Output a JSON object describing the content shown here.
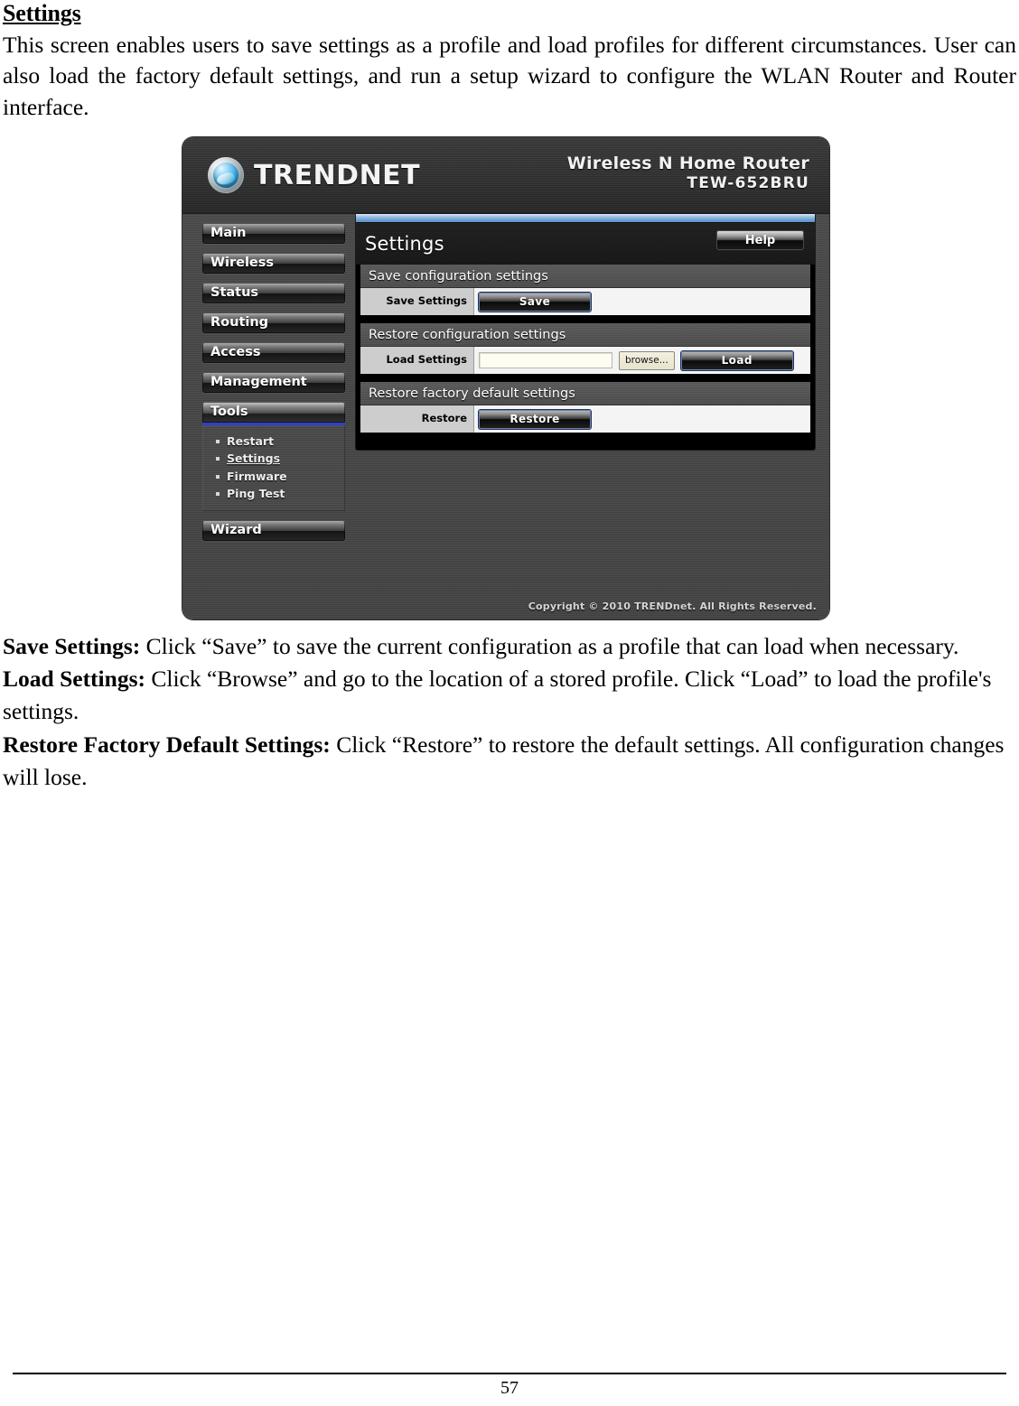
{
  "document": {
    "heading": "Settings",
    "intro": "This screen enables users to save settings as a profile and load profiles for different circumstances. User can also load the factory default settings, and run a setup wizard to configure the WLAN Router and Router interface.",
    "sections": [
      {
        "term": "Save Settings:",
        "text": " Click “Save” to save the current configuration as a profile that can load when necessary."
      },
      {
        "term": "Load Settings:",
        "text": " Click “Browse” and go to the location of a stored profile. Click “Load” to load the profile's settings."
      },
      {
        "term": "Restore Factory Default Settings:",
        "text": " Click “Restore” to restore the default settings. All configuration changes will lose."
      }
    ],
    "page_number": "57"
  },
  "router_ui": {
    "brand": {
      "logo_icon": "trendnet-globe-icon",
      "wordmark": "TRENDNET",
      "product_name": "Wireless N Home Router",
      "model": "TEW-652BRU"
    },
    "sidebar": {
      "items": [
        {
          "label": "Main",
          "active": false
        },
        {
          "label": "Wireless",
          "active": false
        },
        {
          "label": "Status",
          "active": false
        },
        {
          "label": "Routing",
          "active": false
        },
        {
          "label": "Access",
          "active": false
        },
        {
          "label": "Management",
          "active": false
        },
        {
          "label": "Tools",
          "active": true
        }
      ],
      "submenu": [
        {
          "label": "Restart",
          "current": false
        },
        {
          "label": "Settings",
          "current": true
        },
        {
          "label": "Firmware",
          "current": false
        },
        {
          "label": "Ping Test",
          "current": false
        }
      ],
      "wizard": {
        "label": "Wizard",
        "active": false
      }
    },
    "content": {
      "title": "Settings",
      "help_label": "Help",
      "sections": [
        {
          "heading": "Save configuration settings",
          "row_label": "Save Settings",
          "button_label": "Save"
        },
        {
          "heading": "Restore configuration settings",
          "row_label": "Load Settings",
          "input_value": "",
          "input_placeholder": "",
          "browse_label": "browse...",
          "button_label": "Load"
        },
        {
          "heading": "Restore factory default settings",
          "row_label": "Restore",
          "button_label": "Restore"
        }
      ]
    },
    "copyright": "Copyright © 2010 TRENDnet. All Rights Reserved.",
    "colors": {
      "accent_blue": "#2f3fd0",
      "topbar_blue": "#6fa2d4",
      "panel_black": "#000000",
      "chrome_gray": "#474747",
      "row_label_gray": "#cdcdcd",
      "row_value_white": "#f4f4f4"
    }
  }
}
